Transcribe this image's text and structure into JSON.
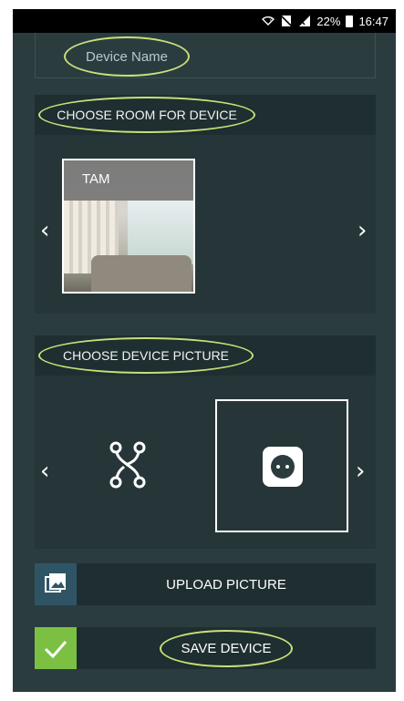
{
  "status_bar": {
    "battery_percent": "22%",
    "time": "16:47"
  },
  "device_name": {
    "placeholder": "Device Name"
  },
  "room_section": {
    "title": "CHOOSE ROOM FOR DEVICE",
    "selected_room": "TAM",
    "prev_icon": "chevron-left",
    "next_icon": "chevron-right"
  },
  "picture_section": {
    "title": "CHOOSE DEVICE PICTURE",
    "options": [
      {
        "icon": "network-node-icon",
        "selected": false
      },
      {
        "icon": "power-socket-icon",
        "selected": true
      }
    ]
  },
  "upload": {
    "label": "UPLOAD PICTURE",
    "icon": "image-gallery-icon"
  },
  "save": {
    "label": "SAVE DEVICE",
    "icon": "checkmark-icon"
  },
  "colors": {
    "background": "#2b3c3f",
    "highlight": "#c8e07a",
    "save_accent": "#7bc043",
    "upload_accent": "#2f5466"
  }
}
